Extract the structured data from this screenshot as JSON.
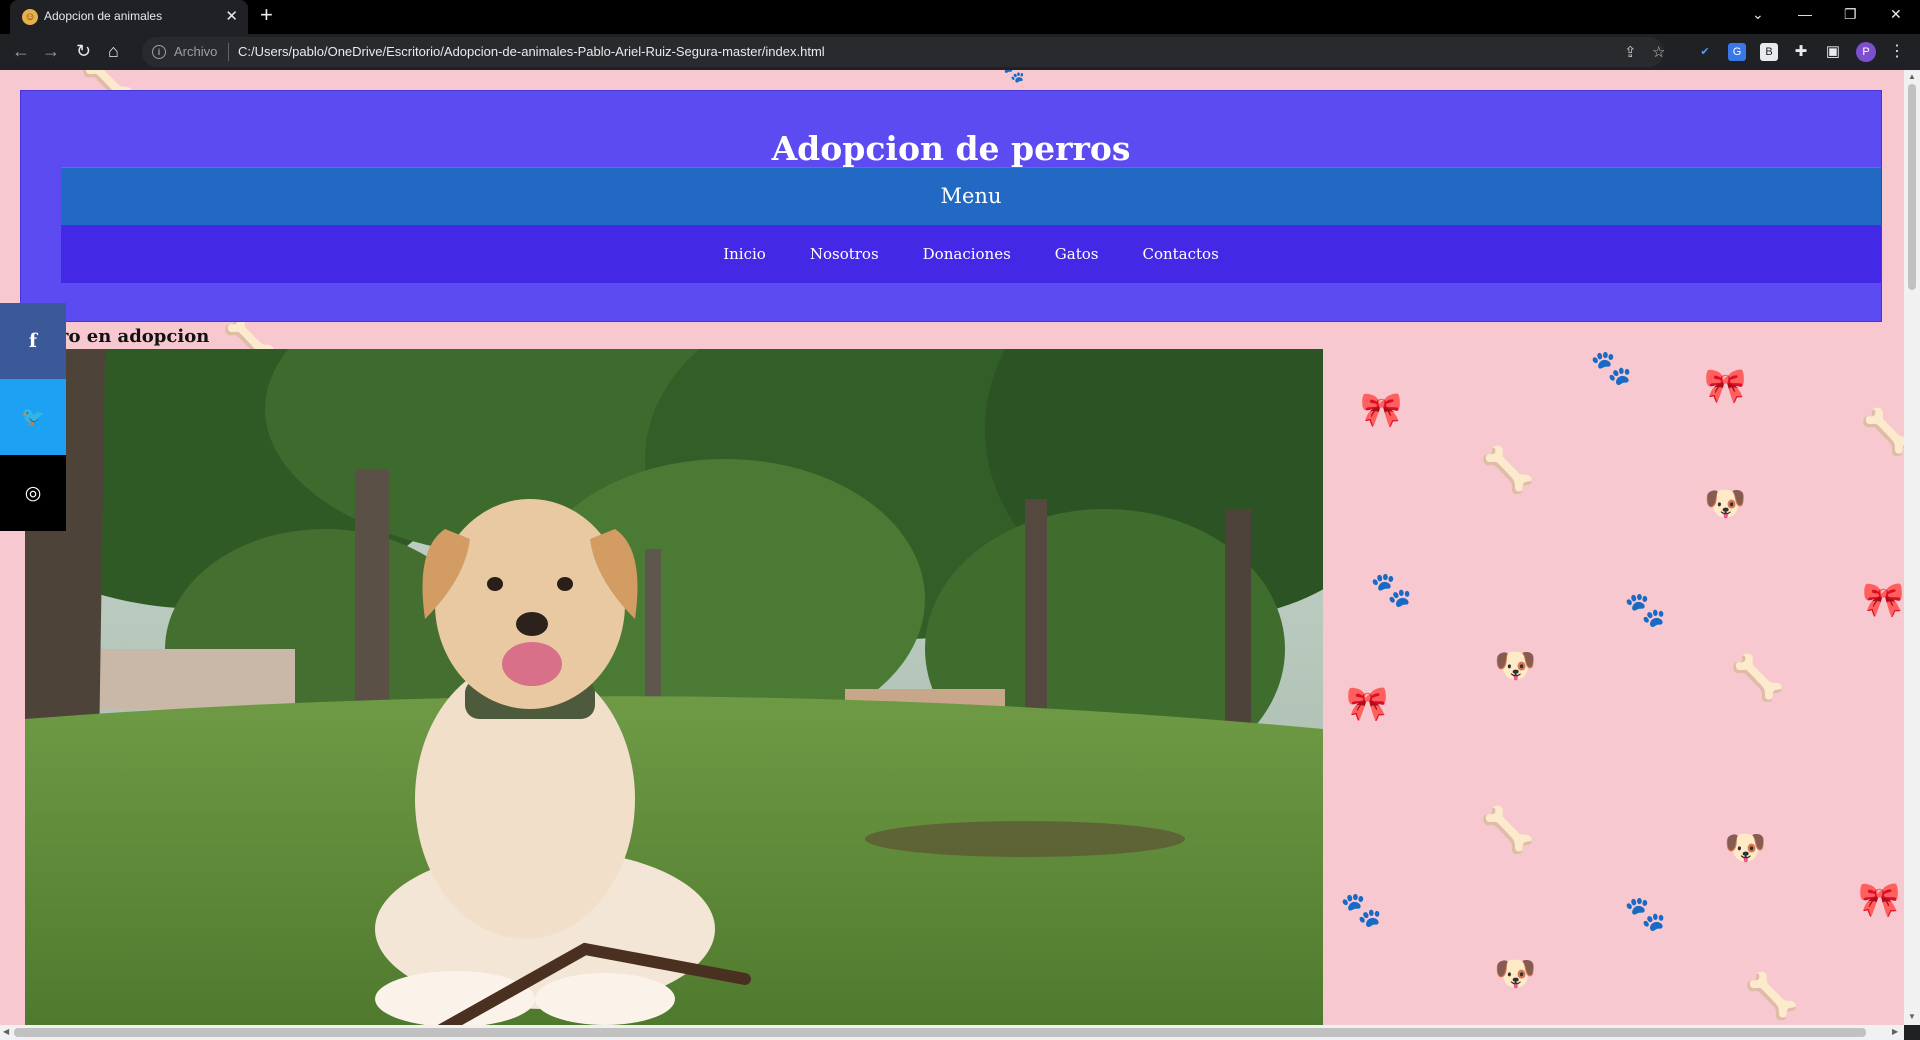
{
  "browser": {
    "tab_title": "Adopcion de animales",
    "address_label": "Archivo",
    "url": "C:/Users/pablo/OneDrive/Escritorio/Adopcion-de-animales-Pablo-Ariel-Ruiz-Segura-master/index.html",
    "profile_initial": "P"
  },
  "site": {
    "title": "Adopcion de perros",
    "menu_label": "Menu",
    "nav": [
      "Inicio",
      "Nosotros",
      "Donaciones",
      "Gatos",
      "Contactos"
    ],
    "section_title": "Perro en adopcion"
  },
  "social": [
    {
      "icon": "facebook-icon",
      "glyph": "f",
      "color": "#3b5998"
    },
    {
      "icon": "twitter-icon",
      "glyph": "t",
      "color": "#1da1f2"
    },
    {
      "icon": "instagram-icon",
      "glyph": "◎",
      "color": "#000000"
    }
  ],
  "colors": {
    "page_background": "#f7c8cf",
    "header": "#5b4bf0",
    "menu_bar": "#2169c2",
    "nav_bar": "#4329e6"
  }
}
